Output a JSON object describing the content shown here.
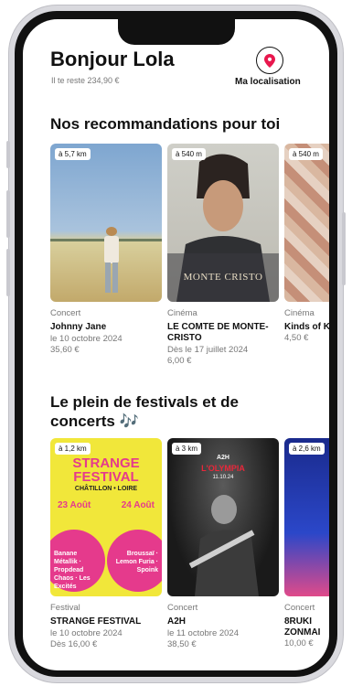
{
  "header": {
    "greeting": "Bonjour Lola",
    "balance": "Il te reste 234,90 €",
    "location_label": "Ma localisation",
    "accent": "#e8174d"
  },
  "recommendations": {
    "title": "Nos recommandations pour toi",
    "items": [
      {
        "distance": "à 5,7 km",
        "category": "Concert",
        "name": "Johnny Jane",
        "date": "le 10 octobre 2024",
        "price": "35,60 €"
      },
      {
        "distance": "à 540 m",
        "category": "Cinéma",
        "name": "LE COMTE DE MONTE-CRISTO",
        "date": "Dès le 17 juillet 2024",
        "price": "6,00 €"
      },
      {
        "distance": "à 540 m",
        "category": "Cinéma",
        "name": "Kinds of Kindness",
        "date": "",
        "price": "4,50 €"
      }
    ]
  },
  "festivals": {
    "title": "Le plein de festivals et de concerts 🎶",
    "items": [
      {
        "distance": "à 1,2 km",
        "category": "Festival",
        "name": "STRANGE FESTIVAL",
        "date": "le 10 octobre 2024",
        "price": "Dès 16,00 €"
      },
      {
        "distance": "à 3 km",
        "category": "Concert",
        "name": "A2H",
        "date": "le 11 octobre 2024",
        "price": "38,50 €"
      },
      {
        "distance": "à 2,6 km",
        "category": "Concert",
        "name": "8RUKI ZONMAI",
        "date": "",
        "price": "10,00 €"
      }
    ]
  },
  "posters": {
    "strange_title": "STRANGE FESTIVAL",
    "strange_place": "CHÂTILLON • LOIRE",
    "strange_day1": "23 Août",
    "strange_day2": "24 Août",
    "strange_lineup1": "Banane Métallik · Propdead Chaos · Les Excités",
    "strange_lineup2": "Broussaï · Lemon Furia · Spoink",
    "a2h_label": "A2H",
    "a2h_venue": "L'OLYMPIA",
    "a2h_date": "11.10.24",
    "monte_title": "MONTE CRISTO"
  }
}
